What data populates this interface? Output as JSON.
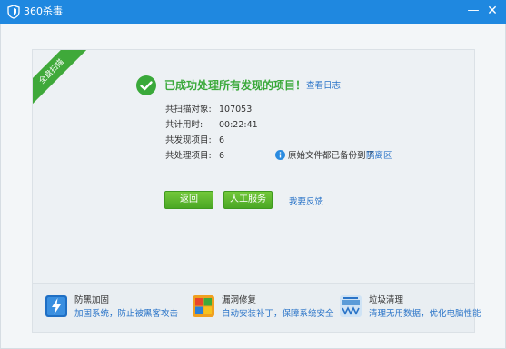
{
  "window": {
    "title": "360杀毒",
    "min_glyph": "—",
    "close_glyph": "✕"
  },
  "ribbon": {
    "label": "全盘扫描"
  },
  "result": {
    "headline": "已成功处理所有发现的项目！",
    "log_link": "查看日志",
    "stats": [
      {
        "label": "共扫描对象:",
        "value": "107053"
      },
      {
        "label": "共计用时:",
        "value": "00:22:41"
      },
      {
        "label": "共发现项目:",
        "value": "6"
      },
      {
        "label": "共处理项目:",
        "value": "6"
      }
    ],
    "note": "原始文件都已备份到了",
    "quarantine_link": "隔离区"
  },
  "actions": {
    "back_label": "返回",
    "service_label": "人工服务",
    "feedback_link": "我要反馈"
  },
  "features": [
    {
      "name": "防黑加固",
      "desc": "加固系统，防止被黑客攻击",
      "icon": "shield-bolt-icon"
    },
    {
      "name": "漏洞修复",
      "desc": "自动安装补丁，保障系统安全",
      "icon": "windows-patch-icon"
    },
    {
      "name": "垃圾清理",
      "desc": "清理无用数据，优化电脑性能",
      "icon": "cleanup-icon"
    }
  ],
  "colors": {
    "titlebar": "#1f88e0",
    "success_green": "#3aa93a",
    "link_blue": "#2a74c8",
    "button_green": "#4aa724"
  }
}
